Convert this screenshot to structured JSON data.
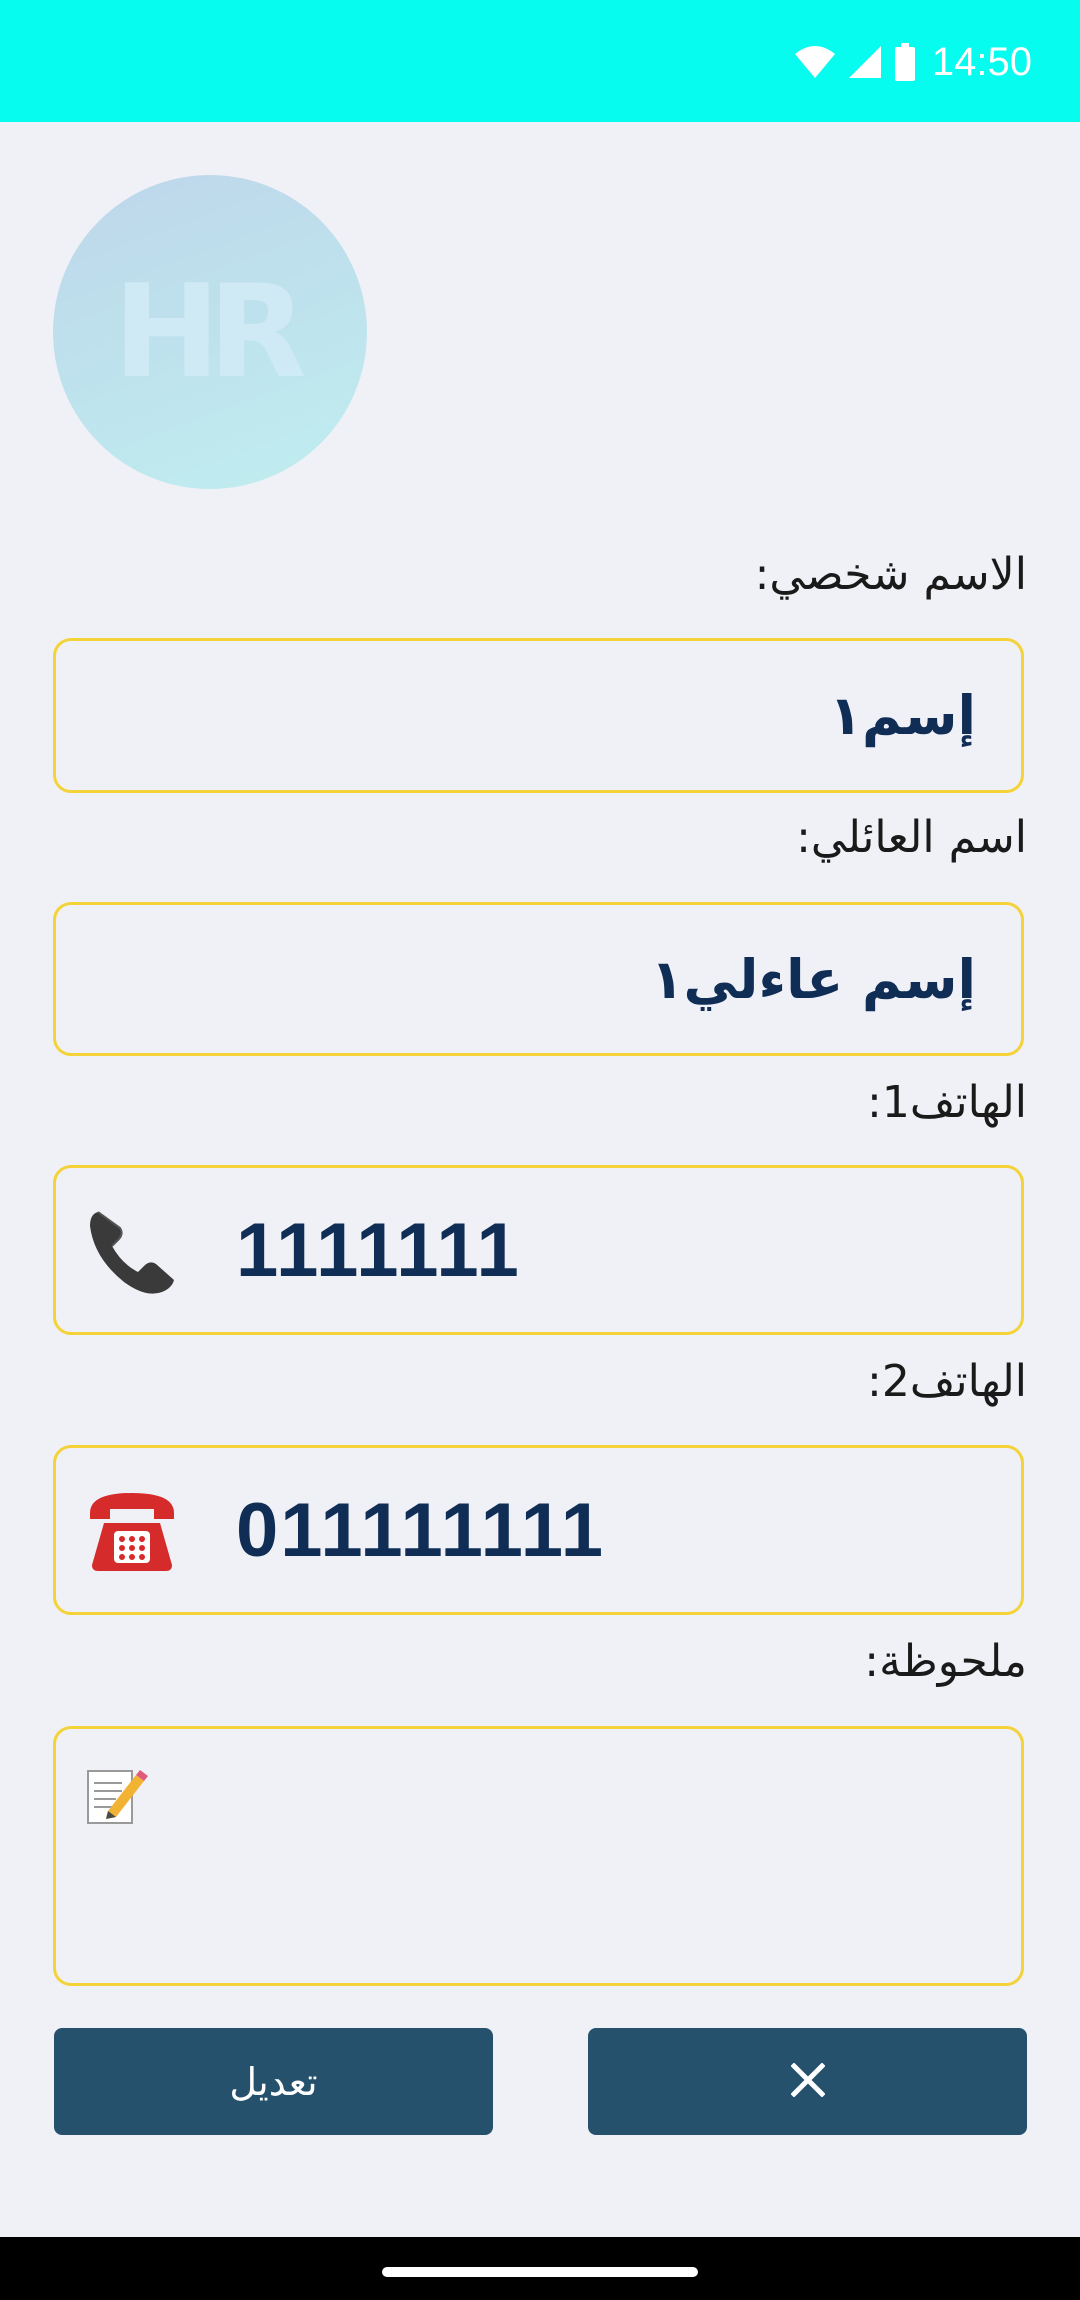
{
  "status_bar": {
    "time": "14:50",
    "icons": [
      "wifi-icon",
      "signal-icon",
      "battery-icon"
    ],
    "background": "#06fcee"
  },
  "avatar": {
    "initials": "HR"
  },
  "form": {
    "first_name": {
      "label": "الاسم شخصي:",
      "value": "إسم١"
    },
    "last_name": {
      "label": "اسم العائلي:",
      "value": "إسم عاءلي١"
    },
    "phone1": {
      "label": "الهاتف1:",
      "value": "1111111",
      "icon": "telephone-receiver-icon"
    },
    "phone2": {
      "label": "الهاتف2:",
      "value": "011111111",
      "icon": "telephone-icon"
    },
    "note": {
      "label": "ملحوظة:",
      "value": "",
      "icon": "memo-icon"
    }
  },
  "buttons": {
    "edit_label": "تعديل",
    "close_label": "✕"
  },
  "colors": {
    "field_border": "#f4d33a",
    "button_bg": "#26516d",
    "value_text": "#0f2d55",
    "page_bg": "#f0f1f7"
  }
}
